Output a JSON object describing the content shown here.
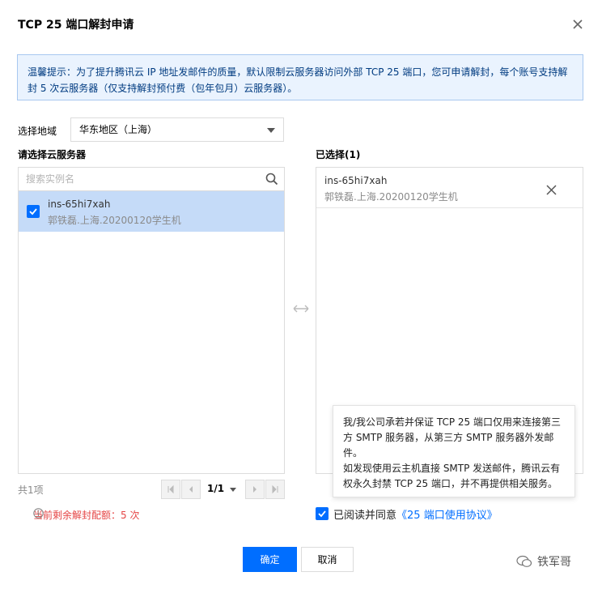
{
  "dialog": {
    "title": "TCP 25 端口解封申请",
    "notice": "温馨提示：为了提升腾讯云 IP 地址发邮件的质量，默认限制云服务器访问外部 TCP 25 端口，您可申请解封，每个账号支持解封 5 次云服务器（仅支持解封预付费（包年包月）云服务器）。"
  },
  "region": {
    "label": "选择地域",
    "value": "华东地区（上海）"
  },
  "left_panel": {
    "label": "请选择云服务器",
    "search_placeholder": "搜索实例名",
    "items": [
      {
        "name": "ins-65hi7xah",
        "sub": "郭铁磊.上海.20200120学生机",
        "checked": true
      }
    ],
    "total": "共1项",
    "pager": "1/1"
  },
  "right_panel": {
    "label": "已选择(1)",
    "items": [
      {
        "name": "ins-65hi7xah",
        "sub": "郭铁磊.上海.20200120学生机"
      }
    ]
  },
  "quota": {
    "text": "当前剩余解封配额：5 次"
  },
  "tooltip": {
    "line1": "我/我公司承若并保证 TCP 25 端口仅用来连接第三方 SMTP 服务器，从第三方 SMTP 服务器外发邮件。",
    "line2": "如发现使用云主机直接 SMTP 发送邮件，腾讯云有权永久封禁 TCP 25 端口，并不再提供相关服务。"
  },
  "agreement": {
    "prefix": "已阅读并同意",
    "link": "《25 端口使用协议》",
    "checked": true
  },
  "buttons": {
    "ok": "确定",
    "cancel": "取消"
  },
  "watermark": "铁军哥",
  "colors": {
    "primary": "#006eff",
    "notice_bg": "#eaf3fe",
    "selected_row": "#c5dbf8",
    "warning": "#e54545"
  }
}
